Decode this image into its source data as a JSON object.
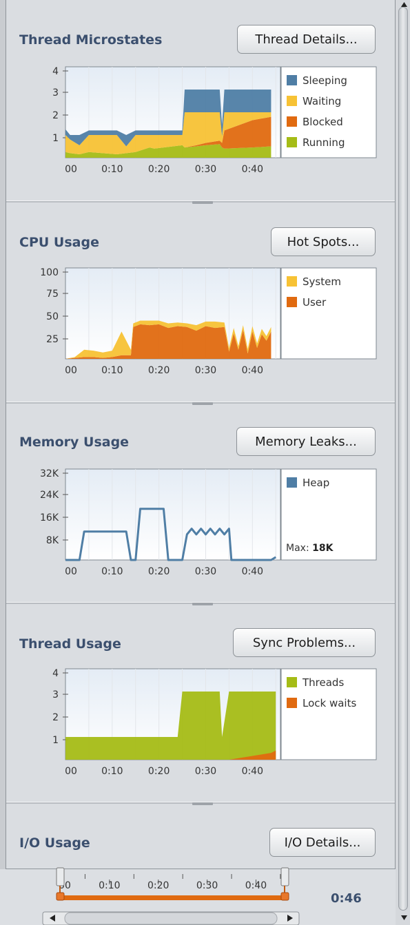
{
  "colors": {
    "title": "#3b4f6e",
    "sleeping": "#4f7ea5",
    "waiting": "#f7c235",
    "blocked": "#e06a10",
    "running": "#a5bc16",
    "system": "#f7c235",
    "user": "#e06a10",
    "heap": "#4f7ea5",
    "threads": "#a5bc16",
    "lockwaits": "#e06a10",
    "timeline": "#e06a10"
  },
  "sections": [
    {
      "title": "Thread Microstates",
      "button": "Thread Details...",
      "chart_data": {
        "type": "area",
        "x": [
          0,
          1,
          3,
          5,
          8,
          11,
          13,
          15,
          18,
          19,
          21,
          23,
          25,
          25.5,
          28,
          30,
          33,
          33.5,
          34,
          40,
          44
        ],
        "xlabel_ticks": [
          "00",
          "0:10",
          "0:20",
          "0:30",
          "0:40"
        ],
        "yticks": [
          "4",
          "3",
          "2",
          "1"
        ],
        "ylim": [
          0,
          4
        ],
        "xlim": [
          0,
          46
        ],
        "stacked": true,
        "series": [
          {
            "name": "Running",
            "values": [
              0.25,
              0.2,
              0.15,
              0.25,
              0.2,
              0.15,
              0.2,
              0.25,
              0.45,
              0.4,
              0.45,
              0.5,
              0.55,
              0.45,
              0.5,
              0.55,
              0.6,
              0.45,
              0.4,
              0.45,
              0.5
            ]
          },
          {
            "name": "Blocked",
            "values": [
              0,
              0,
              0,
              0,
              0,
              0,
              0,
              0,
              0,
              0,
              0,
              0,
              0,
              0,
              0.05,
              0.1,
              0.15,
              0.2,
              0.8,
              1.2,
              1.3
            ]
          },
          {
            "name": "Waiting",
            "values": [
              0.75,
              0.6,
              0.4,
              0.75,
              0.8,
              0.85,
              0.3,
              0.75,
              0.55,
              0.6,
              0.55,
              0.5,
              0.45,
              1.55,
              1.45,
              1.35,
              1.25,
              0.3,
              0.8,
              0.35,
              0.2
            ]
          },
          {
            "name": "Sleeping",
            "values": [
              0.25,
              0.2,
              0.45,
              0.2,
              0.2,
              0.2,
              0.5,
              0.2,
              0.2,
              0.2,
              0.2,
              0.2,
              0.2,
              1.0,
              1.0,
              1.0,
              1.0,
              0.5,
              1.0,
              1.0,
              1.0
            ]
          }
        ],
        "legend": [
          "Sleeping",
          "Waiting",
          "Blocked",
          "Running"
        ],
        "legend_placement": "right"
      }
    },
    {
      "title": "CPU Usage",
      "button": "Hot Spots...",
      "chart_data": {
        "type": "area",
        "x": [
          0,
          2,
          4,
          6,
          8,
          10,
          12,
          14,
          14.5,
          16,
          18,
          20,
          22,
          24,
          26,
          28,
          30,
          32,
          34,
          35,
          36,
          37,
          38,
          39,
          40,
          41,
          42,
          43,
          44
        ],
        "xlabel_ticks": [
          "00",
          "0:10",
          "0:20",
          "0:30",
          "0:40"
        ],
        "yticks": [
          "100",
          "75",
          "50",
          "25"
        ],
        "ylim": [
          0,
          100
        ],
        "xlim": [
          0,
          46
        ],
        "stacked": true,
        "series": [
          {
            "name": "User",
            "values": [
              0,
              1,
              2,
              2,
              1,
              2,
              4,
              4,
              35,
              38,
              37,
              38,
              34,
              36,
              35,
              31,
              36,
              34,
              35,
              8,
              28,
              10,
              32,
              6,
              30,
              12,
              27,
              20,
              30
            ]
          },
          {
            "name": "System",
            "values": [
              0,
              1,
              8,
              7,
              6,
              7,
              26,
              6,
              4,
              4,
              5,
              4,
              5,
              4,
              4,
              6,
              5,
              7,
              5,
              4,
              6,
              4,
              5,
              5,
              6,
              5,
              6,
              5,
              5
            ]
          }
        ],
        "legend": [
          "System",
          "User"
        ],
        "legend_placement": "right"
      }
    },
    {
      "title": "Memory Usage",
      "button": "Memory Leaks...",
      "chart_data": {
        "type": "line",
        "x": [
          0,
          3,
          4,
          13,
          14,
          15,
          16,
          21,
          22,
          25,
          26,
          27,
          28,
          29,
          30,
          31,
          32,
          33,
          34,
          35,
          35.5,
          44,
          45
        ],
        "xlabel_ticks": [
          "00",
          "0:10",
          "0:20",
          "0:30",
          "0:40"
        ],
        "yticks": [
          "32K",
          "24K",
          "16K",
          "8K"
        ],
        "ylim": [
          0,
          32
        ],
        "xlim": [
          0,
          46
        ],
        "series": [
          {
            "name": "Heap",
            "values": [
              0,
              0,
              10,
              10,
              0,
              0,
              18,
              18,
              0,
              0,
              9,
              11,
              9,
              11,
              9,
              11,
              9,
              11,
              9,
              11,
              0,
              0,
              1
            ]
          }
        ],
        "legend": [
          "Heap"
        ],
        "legend_placement": "right",
        "max_label": "Max:",
        "max_value": "18K"
      }
    },
    {
      "title": "Thread Usage",
      "button": "Sync Problems...",
      "chart_data": {
        "type": "area",
        "x": [
          0,
          23,
          24,
          25,
          33,
          33.5,
          35,
          44,
          45
        ],
        "xlabel_ticks": [
          "00",
          "0:10",
          "0:20",
          "0:30",
          "0:40"
        ],
        "yticks": [
          "4",
          "3",
          "2",
          "1"
        ],
        "ylim": [
          0,
          4
        ],
        "xlim": [
          0,
          46
        ],
        "stacked": false,
        "series": [
          {
            "name": "Threads",
            "values": [
              1,
              1,
              1,
              3,
              3,
              1,
              3,
              3,
              3
            ]
          },
          {
            "name": "Lock waits",
            "values": [
              0,
              0,
              0,
              0,
              0,
              0,
              0,
              0.3,
              0.4
            ]
          }
        ],
        "legend": [
          "Threads",
          "Lock waits"
        ],
        "legend_placement": "right"
      }
    },
    {
      "title": "I/O Usage",
      "button": "I/O Details..."
    }
  ],
  "timeline": {
    "ticks": [
      "00",
      "0:10",
      "0:20",
      "0:30",
      "0:40"
    ],
    "elapsed": "0:46"
  },
  "icons": {
    "scroll_up": "triangle-up-icon",
    "scroll_down": "triangle-down-icon",
    "scroll_left": "triangle-left-icon",
    "scroll_right": "triangle-right-icon"
  }
}
